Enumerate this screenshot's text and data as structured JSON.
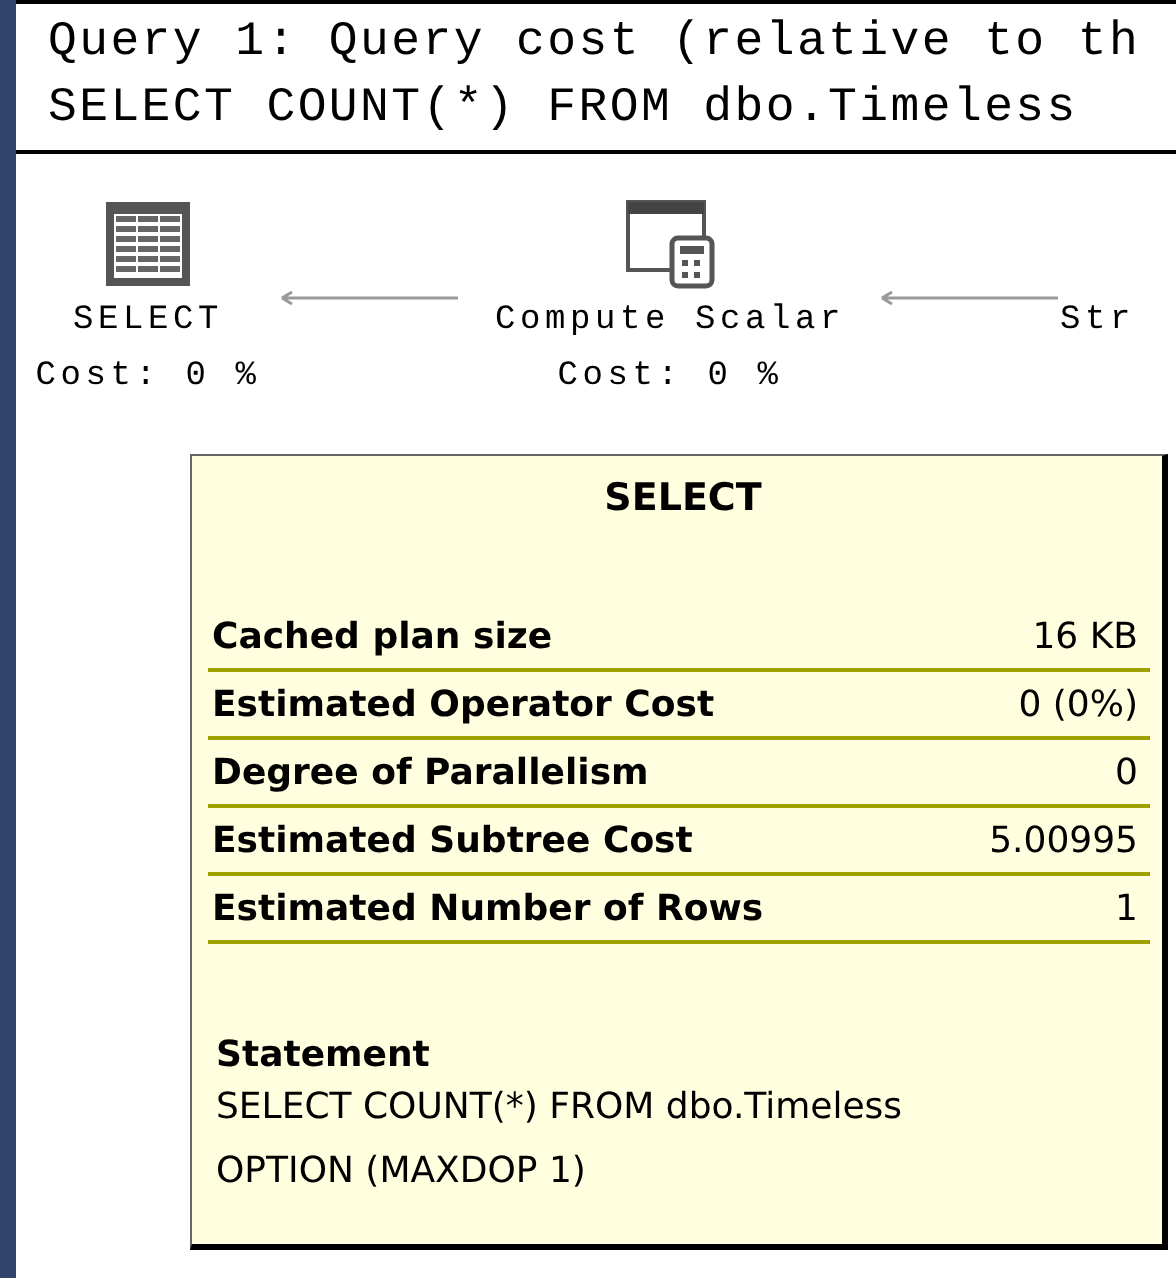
{
  "header": {
    "lines": [
      "Query 1: Query cost (relative to th",
      "SELECT COUNT(*) FROM dbo.Timeless"
    ]
  },
  "nodes": [
    {
      "kind": "table",
      "name": "SELECT",
      "cost": "Cost: 0 %"
    },
    {
      "kind": "calculator",
      "name": "Compute Scalar",
      "cost": "Cost: 0 %"
    },
    {
      "kind": "cut",
      "name": "Str"
    }
  ],
  "tooltip": {
    "title": "SELECT",
    "rows": [
      {
        "label": "Cached plan size",
        "value": "16 KB"
      },
      {
        "label": "Estimated Operator Cost",
        "value": "0 (0%)"
      },
      {
        "label": "Degree of Parallelism",
        "value": "0"
      },
      {
        "label": "Estimated Subtree Cost",
        "value": "5.00995"
      },
      {
        "label": "Estimated Number of Rows",
        "value": "1"
      }
    ],
    "statement_label": "Statement",
    "statement_lines": [
      "SELECT COUNT(*) FROM dbo.Timeless",
      "OPTION (MAXDOP 1)"
    ]
  }
}
